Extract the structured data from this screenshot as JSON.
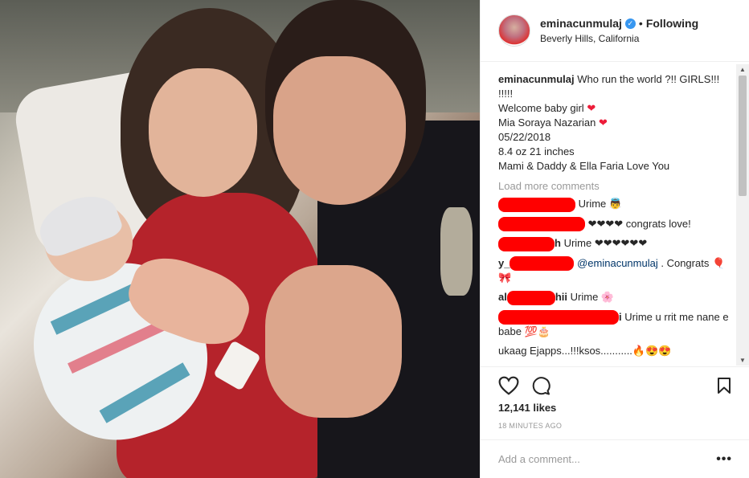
{
  "header": {
    "username": "eminacunmulaj",
    "verified_glyph": "✓",
    "dot": "•",
    "following": "Following",
    "location": "Beverly Hills, California"
  },
  "caption": {
    "username": "eminacunmulaj",
    "line1": "Who run the world ?!! GIRLS!!! !!!!!",
    "line2": "Welcome baby girl",
    "line3": "Mia Soraya Nazarian",
    "line4": "05/22/2018",
    "line5": "8.4 oz 21 inches",
    "line6": "Mami & Daddy & Ella Faria Love You",
    "heart": "❤"
  },
  "load_more": "Load more comments",
  "comments": [
    {
      "text": "Urime 👼"
    },
    {
      "text": "❤❤❤❤ congrats love!"
    },
    {
      "visible_prefix": "h",
      "text": "Urime ❤❤❤❤❤❤"
    },
    {
      "visible_prefix": "y_",
      "mention": "@eminacunmulaj",
      "text": ". Congrats 🎈🎀"
    },
    {
      "visible_prefix": "al",
      "visible_mid": "hii",
      "text": "Urime 🌸"
    },
    {
      "visible_prefix": "i",
      "text": "Urime u rrit me nane e babe 💯🎂"
    },
    {
      "text": "ukaag Ejapps...!!!ksos...........🔥😍😍"
    }
  ],
  "likes": "12,141 likes",
  "time": "18 MINUTES AGO",
  "add_comment": {
    "placeholder": "Add a comment..."
  },
  "more_glyph": "•••",
  "icons": {
    "like": "heart-outline-icon",
    "comment": "comment-bubble-icon",
    "save": "bookmark-icon",
    "verified": "verified-badge-icon"
  },
  "colors": {
    "verified": "#3897f0",
    "heart": "#ed1c39",
    "redaction": "#ff0000",
    "muted": "#999999"
  }
}
